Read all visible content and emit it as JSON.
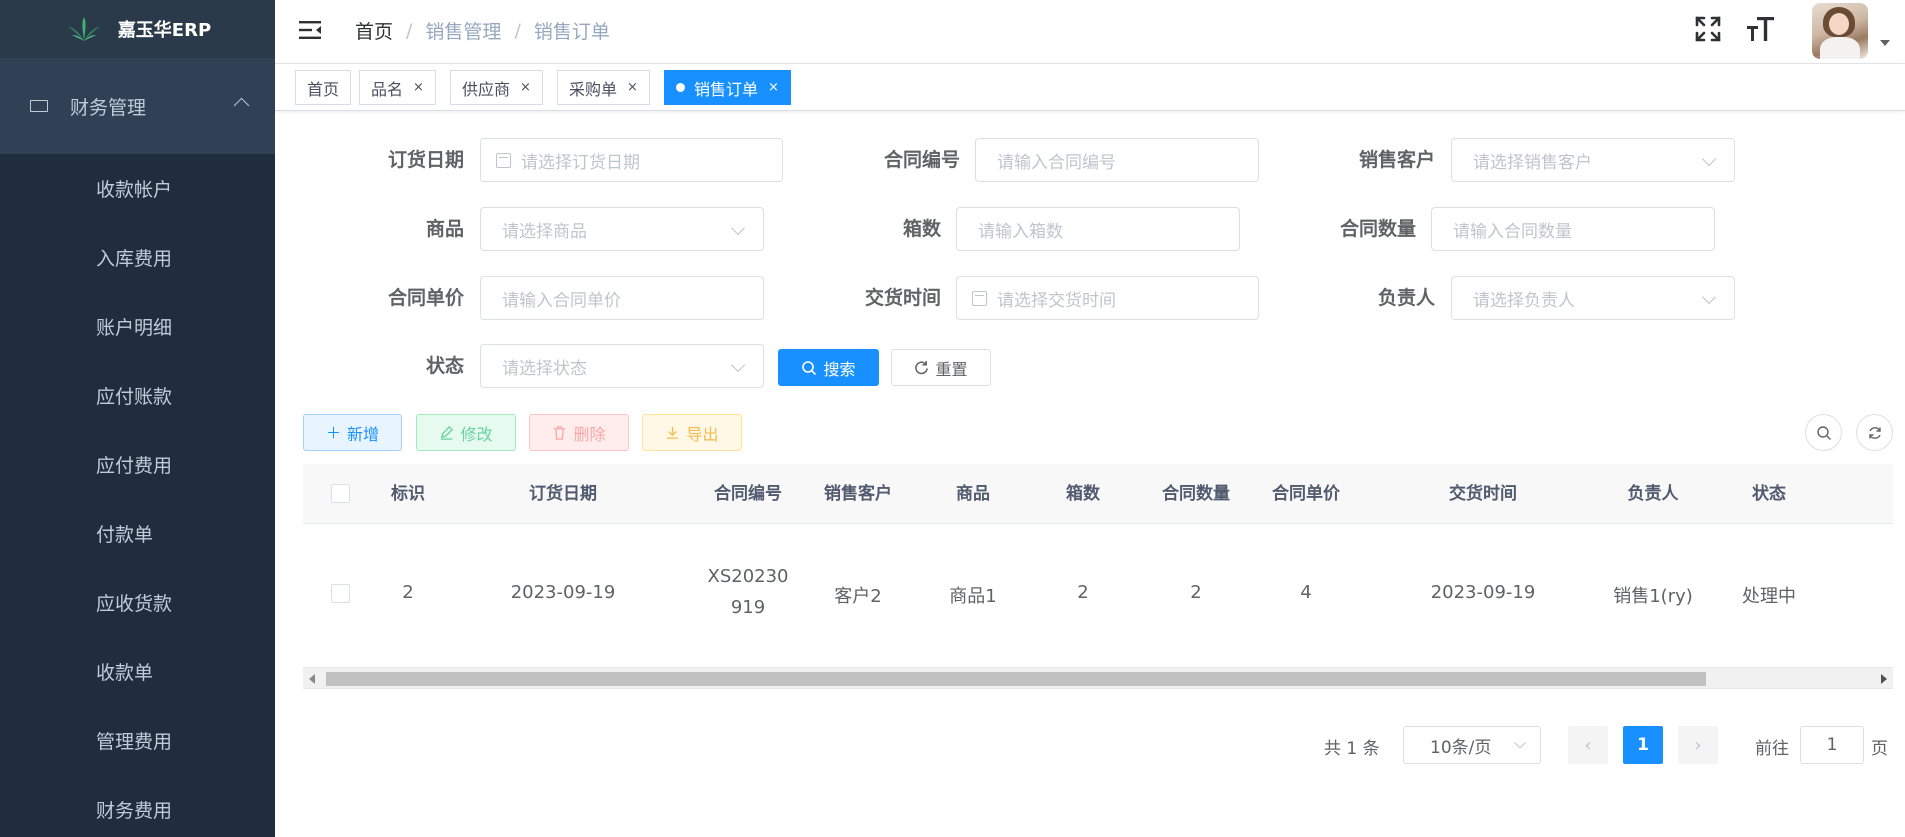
{
  "app": {
    "brand": "嘉玉华ERP"
  },
  "sidebar": {
    "group_label": "财务管理",
    "items": [
      {
        "label": "收款帐户"
      },
      {
        "label": "入库费用"
      },
      {
        "label": "账户明细"
      },
      {
        "label": "应付账款"
      },
      {
        "label": "应付费用"
      },
      {
        "label": "付款单"
      },
      {
        "label": "应收货款"
      },
      {
        "label": "收款单"
      },
      {
        "label": "管理费用"
      },
      {
        "label": "财务费用"
      }
    ]
  },
  "header": {
    "breadcrumb": [
      "首页",
      "销售管理",
      "销售订单"
    ],
    "separator": "/"
  },
  "tags": [
    {
      "label": "首页",
      "closable": false
    },
    {
      "label": "品名",
      "closable": true
    },
    {
      "label": "供应商",
      "closable": true
    },
    {
      "label": "采购单",
      "closable": true
    },
    {
      "label": "销售订单",
      "closable": true,
      "active": true
    }
  ],
  "tag_close": "×",
  "form": {
    "order_date": {
      "label": "订货日期",
      "placeholder": "请选择订货日期"
    },
    "contract_no": {
      "label": "合同编号",
      "placeholder": "请输入合同编号"
    },
    "customer": {
      "label": "销售客户",
      "placeholder": "请选择销售客户"
    },
    "product": {
      "label": "商品",
      "placeholder": "请选择商品"
    },
    "boxes": {
      "label": "箱数",
      "placeholder": "请输入箱数"
    },
    "contract_qty": {
      "label": "合同数量",
      "placeholder": "请输入合同数量"
    },
    "unit_price": {
      "label": "合同单价",
      "placeholder": "请输入合同单价"
    },
    "delivery_time": {
      "label": "交货时间",
      "placeholder": "请选择交货时间"
    },
    "owner": {
      "label": "负责人",
      "placeholder": "请选择负责人"
    },
    "status": {
      "label": "状态",
      "placeholder": "请选择状态"
    },
    "search_label": "搜索",
    "reset_label": "重置"
  },
  "toolbar": {
    "add_label": "新增",
    "edit_label": "修改",
    "delete_label": "删除",
    "export_label": "导出"
  },
  "table": {
    "columns": [
      "标识",
      "订货日期",
      "合同编号",
      "销售客户",
      "商品",
      "箱数",
      "合同数量",
      "合同单价",
      "交货时间",
      "负责人",
      "状态"
    ],
    "rows": [
      {
        "id": "2",
        "order_date": "2023-09-19",
        "contract_no_line1": "XS20230",
        "contract_no_line2": "919",
        "customer": "客户2",
        "product": "商品1",
        "boxes": "2",
        "contract_qty": "2",
        "unit_price": "4",
        "delivery_time": "2023-09-19",
        "owner": "销售1(ry)",
        "status": "处理中"
      }
    ]
  },
  "pagination": {
    "total_text": "共 1 条",
    "page_size": "10条/页",
    "current_page": "1",
    "goto_prefix": "前往",
    "goto_value": "1",
    "goto_suffix": "页"
  },
  "colors": {
    "sidebar_bg": "#1f2d3d",
    "sidebar_group_bg": "#304156",
    "primary": "#1890ff"
  }
}
